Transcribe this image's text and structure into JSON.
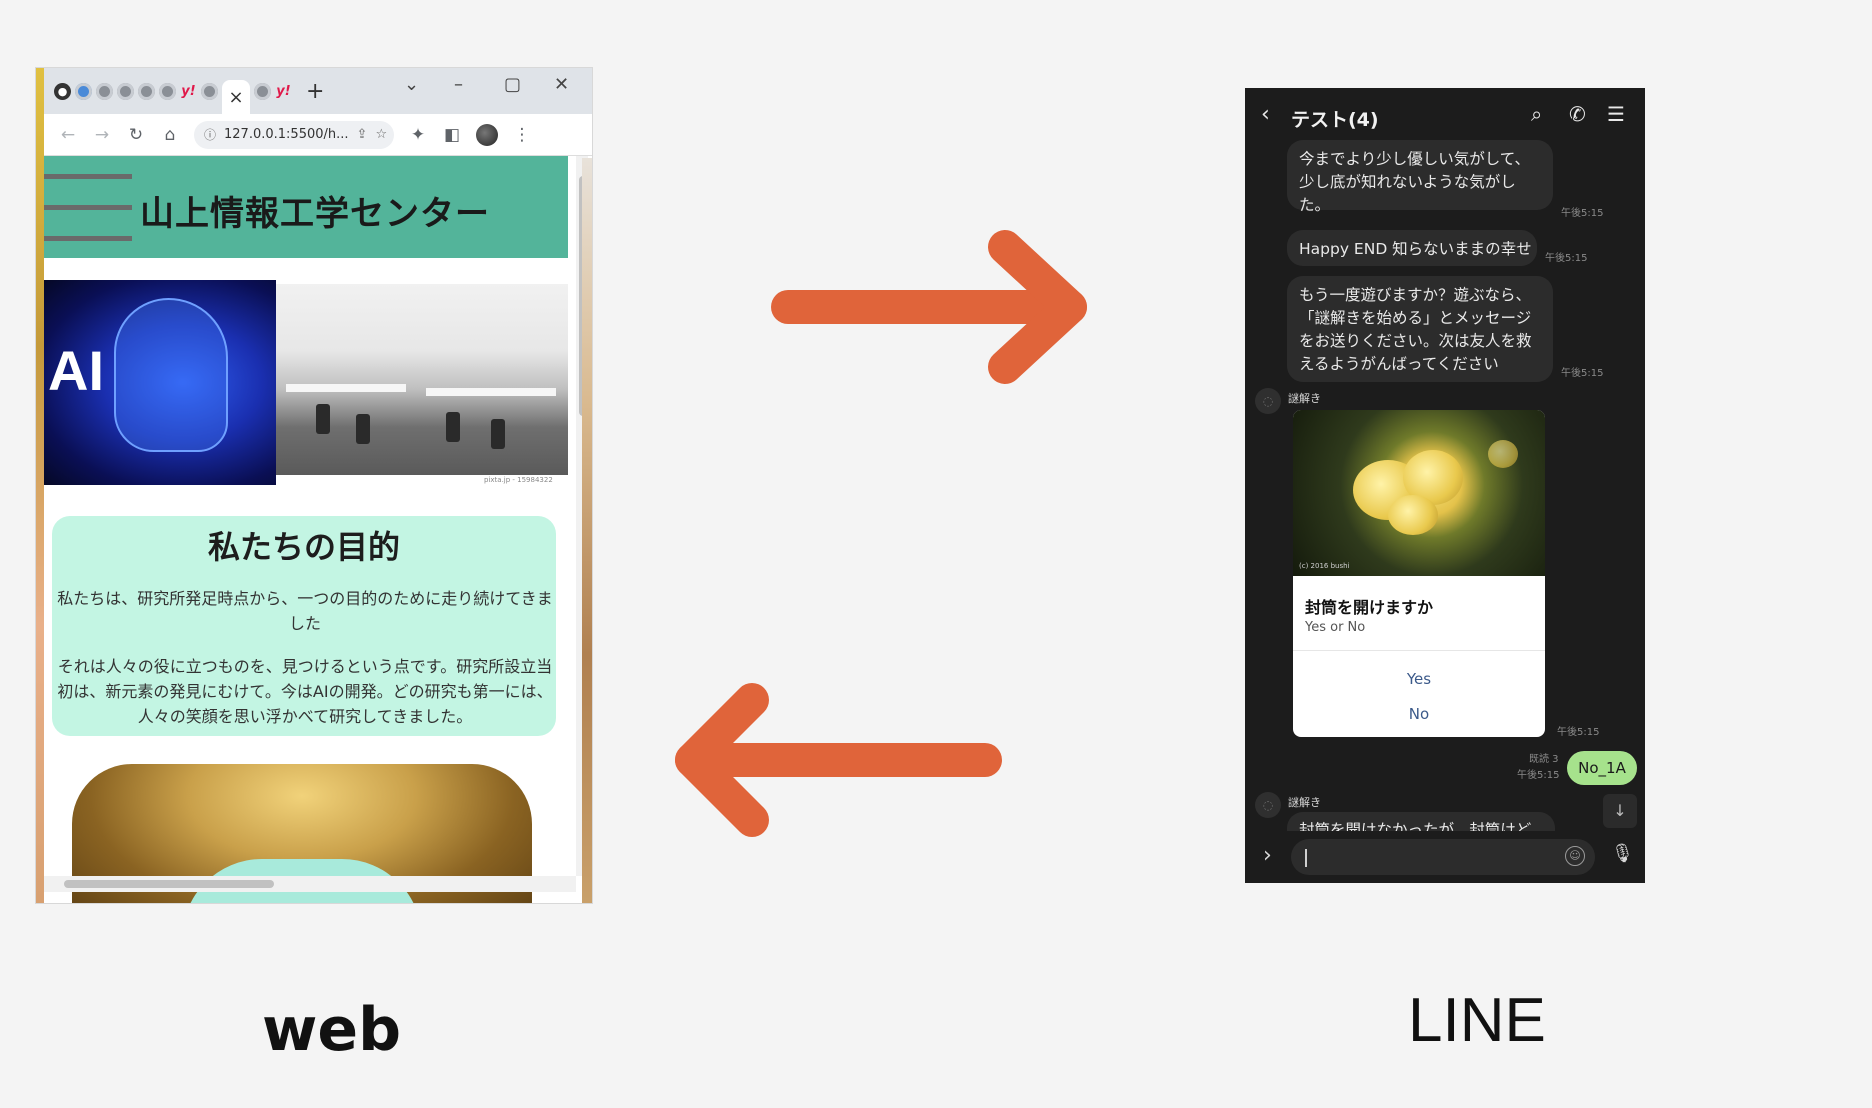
{
  "colors": {
    "background": "#f4f4f4",
    "arrow": "#e0643a",
    "header_green": "#53b49a",
    "purpose_bg": "#c3f5e3",
    "line_dark": "#1c1c1c",
    "line_outgoing": "#a6e28c"
  },
  "web": {
    "label": "web",
    "browser": {
      "tab_icons": [
        "github-icon",
        "bluetooth-icon",
        "globe-icon",
        "globe-icon",
        "globe-icon",
        "globe-icon",
        "yahoo-icon",
        "globe-icon"
      ],
      "close_tab": "×",
      "new_tab": "+",
      "address": "127.0.0.1:5500/h..."
    },
    "page": {
      "site_title": "山上情報工学センター",
      "hero_ai_text": "AI",
      "photo_credit": "pixta.jp - 15984322",
      "purpose_title": "私たちの目的",
      "purpose_p1": "私たちは、研究所発足時点から、一つの目的のために走り続けてきました",
      "purpose_p2": "それは人々の役に立つものを、見つけるという点です。研究所設立当初は、新元素の発見にむけて。今はAIの開発。どの研究も第一には、人々の笑顔を思い浮かべて研究してきました。"
    }
  },
  "line": {
    "label": "LINE",
    "header_title": "テスト(4)",
    "messages": [
      {
        "text": "今までより少し優しい気がして、少し底が知れないような気がした。",
        "time": "午後5:15"
      },
      {
        "text": "Happy END 知らないままの幸せ",
        "time": "午後5:15"
      },
      {
        "text": "もう一度遊びますか？遊ぶなら、「謎解きを始める」とメッセージをお送りください。次は友人を救えるようがんばってください",
        "time": "午後5:15"
      }
    ],
    "sender_name": "謎解き",
    "card": {
      "image_credit": "(c) 2016 bushi",
      "title": "封筒を開けますか",
      "subtitle": "Yes or No",
      "yes_label": "Yes",
      "no_label": "No",
      "time": "午後5:15"
    },
    "outgoing": {
      "text": "No_1A",
      "read": "既読 3",
      "time": "午後5:15"
    },
    "partial_message": "封筒を開けなかったが、封筒けど"
  }
}
